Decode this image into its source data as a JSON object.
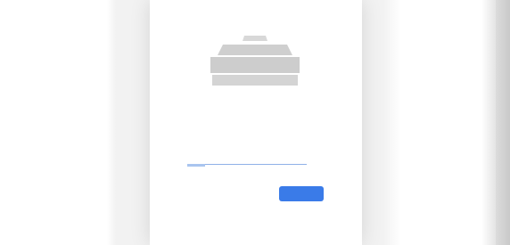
{
  "login": {
    "logo_label": "",
    "subtitle": "",
    "account_link": "",
    "input_value": "",
    "input_placeholder": "",
    "secondary_link": "",
    "next_button": ""
  },
  "footer": {
    "left": "",
    "middle": "",
    "right": ""
  },
  "colors": {
    "accent": "#3a7be8",
    "link": "#7aa6e4",
    "background": "#f2f2f2"
  }
}
